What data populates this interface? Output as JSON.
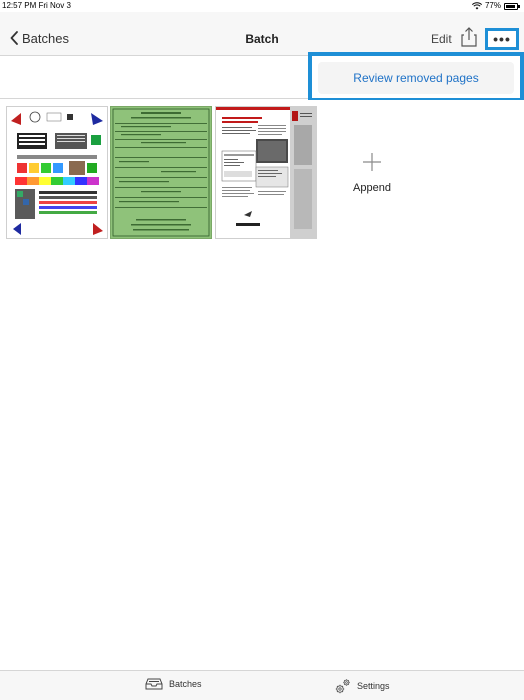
{
  "status_bar": {
    "time": "12:57 PM  Fri Nov 3",
    "battery": "77%"
  },
  "nav": {
    "back_label": "Batches",
    "title": "Batch",
    "edit_label": "Edit"
  },
  "popover": {
    "item_label": "Review removed pages"
  },
  "content": {
    "append_label": "Append"
  },
  "tab_bar": {
    "batches_label": "Batches",
    "settings_label": "Settings"
  },
  "colors": {
    "accent": "#1e8fd6",
    "link": "#1f72c7",
    "page_green": "#8fc27a"
  }
}
